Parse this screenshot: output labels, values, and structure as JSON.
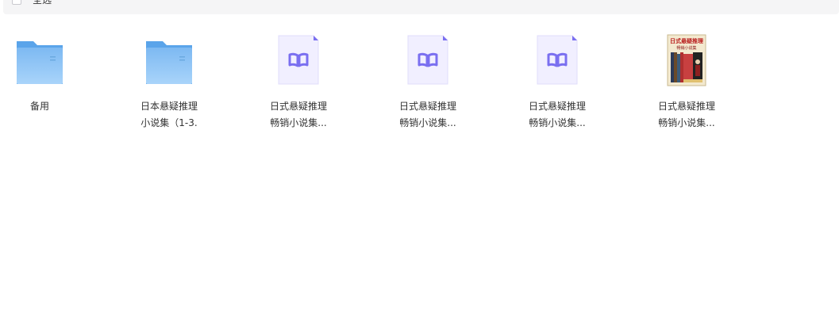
{
  "toolbar": {
    "select_all_label": "全选"
  },
  "files": [
    {
      "type": "folder",
      "icon": "folder-icon",
      "line1": "备用",
      "line2": ""
    },
    {
      "type": "folder",
      "icon": "folder-icon",
      "line1": "日本悬疑推理",
      "line2": "小说集（1-3."
    },
    {
      "type": "ebook",
      "icon": "book-icon",
      "line1": "日式悬疑推理",
      "line2": "畅销小说集..."
    },
    {
      "type": "ebook",
      "icon": "book-icon",
      "line1": "日式悬疑推理",
      "line2": "畅销小说集..."
    },
    {
      "type": "ebook",
      "icon": "book-icon",
      "line1": "日式悬疑推理",
      "line2": "畅销小说集..."
    },
    {
      "type": "image",
      "icon": "book-cover-thumbnail",
      "line1": "日式悬疑推理",
      "line2": "畅销小说集...",
      "cover_title_line1": "日式悬疑推理",
      "cover_title_line2": "畅销小说集"
    }
  ],
  "colors": {
    "folder": "#6fb3f2",
    "folder_light": "#9ccdf8",
    "ebook_bg": "#f0efff",
    "ebook_accent": "#7a6ff0",
    "toolbar_bg": "#f5f5f6"
  }
}
